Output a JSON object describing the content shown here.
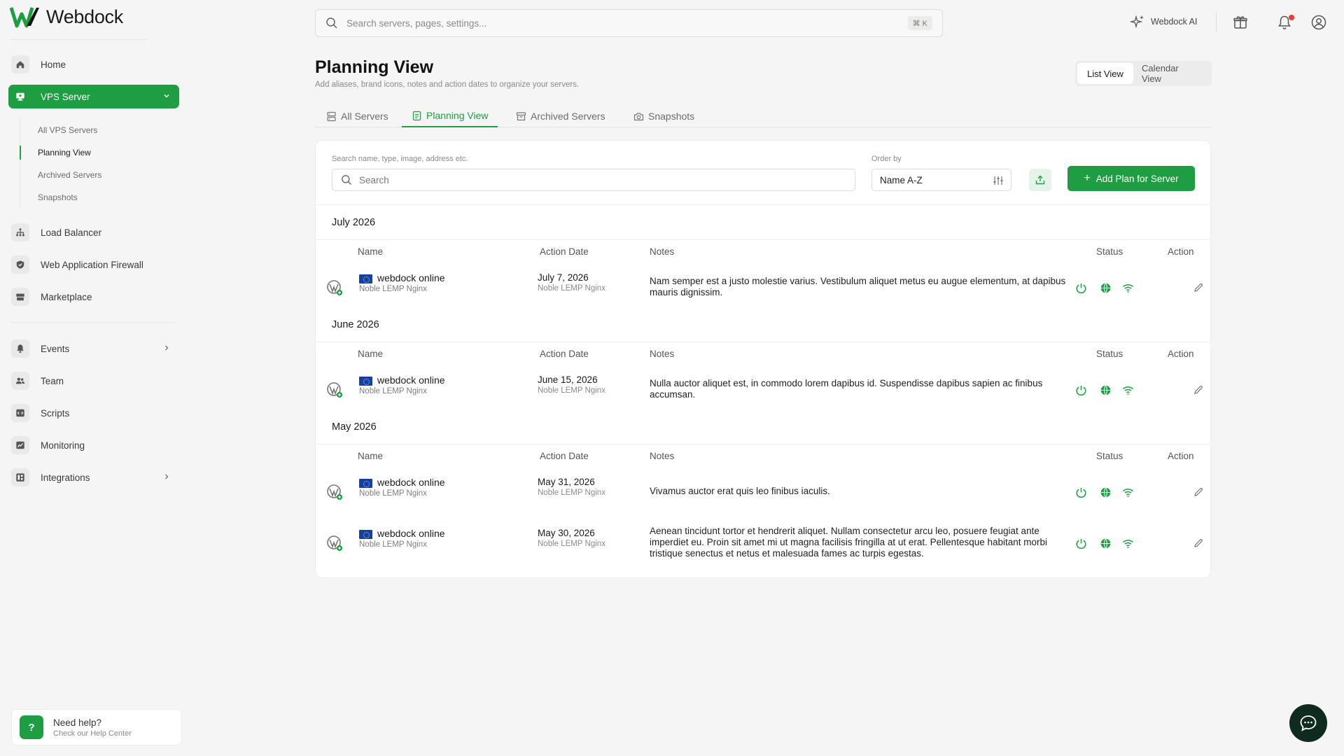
{
  "brand": {
    "name": "Webdock",
    "accent": "#1f9d42"
  },
  "topbar": {
    "search_placeholder": "Search servers, pages, settings...",
    "shortcut": "⌘ K",
    "ai_label": "Webdock AI"
  },
  "sidebar": {
    "home": "Home",
    "vps": "VPS Server",
    "sub": [
      "All VPS Servers",
      "Planning View",
      "Archived Servers",
      "Snapshots"
    ],
    "load_balancer": "Load Balancer",
    "waf": "Web Application Firewall",
    "marketplace": "Marketplace",
    "events": "Events",
    "team": "Team",
    "scripts": "Scripts",
    "monitoring": "Monitoring",
    "integrations": "Integrations",
    "help_title": "Need help?",
    "help_sub": "Check our Help Center"
  },
  "header": {
    "title": "Planning View",
    "subtitle": "Add aliases, brand icons, notes and action dates to organize your servers.",
    "views": [
      "List View",
      "Calendar View"
    ]
  },
  "tabs": [
    "All Servers",
    "Planning View",
    "Archived Servers",
    "Snapshots"
  ],
  "filters": {
    "search_label": "Search name, type, image, address etc.",
    "search_placeholder": "Search",
    "order_label": "Order by",
    "order_value": "Name A-Z",
    "add_label": "Add Plan for Server"
  },
  "columns": {
    "name": "Name",
    "date": "Action Date",
    "notes": "Notes",
    "status": "Status",
    "action": "Action"
  },
  "months": [
    {
      "label": "July 2026",
      "rows": [
        {
          "name": "webdock online",
          "stack": "Noble LEMP Nginx",
          "date": "July 7, 2026",
          "date_sub": "Noble LEMP Nginx",
          "note": "Nam semper est a justo molestie varius. Vestibulum aliquet metus eu augue elementum, at dapibus mauris dignissim."
        }
      ]
    },
    {
      "label": "June 2026",
      "rows": [
        {
          "name": "webdock online",
          "stack": "Noble LEMP Nginx",
          "date": "June 15, 2026",
          "date_sub": "Noble LEMP Nginx",
          "note": "Nulla auctor aliquet est, in commodo lorem dapibus id. Suspendisse dapibus sapien ac finibus accumsan."
        }
      ]
    },
    {
      "label": "May 2026",
      "rows": [
        {
          "name": "webdock online",
          "stack": "Noble LEMP Nginx",
          "date": "May 31, 2026",
          "date_sub": "Noble LEMP Nginx",
          "note": "Vivamus auctor erat quis leo finibus iaculis."
        },
        {
          "name": "webdock online",
          "stack": "Noble LEMP Nginx",
          "date": "May 30, 2026",
          "date_sub": "Noble LEMP Nginx",
          "note": "Aenean tincidunt tortor et hendrerit aliquet. Nullam consectetur arcu leo, posuere feugiat ante imperdiet eu. Proin sit amet mi ut magna facilisis fringilla at ut erat. Pellentesque habitant morbi tristique senectus et netus et malesuada fames ac turpis egestas."
        }
      ]
    }
  ]
}
